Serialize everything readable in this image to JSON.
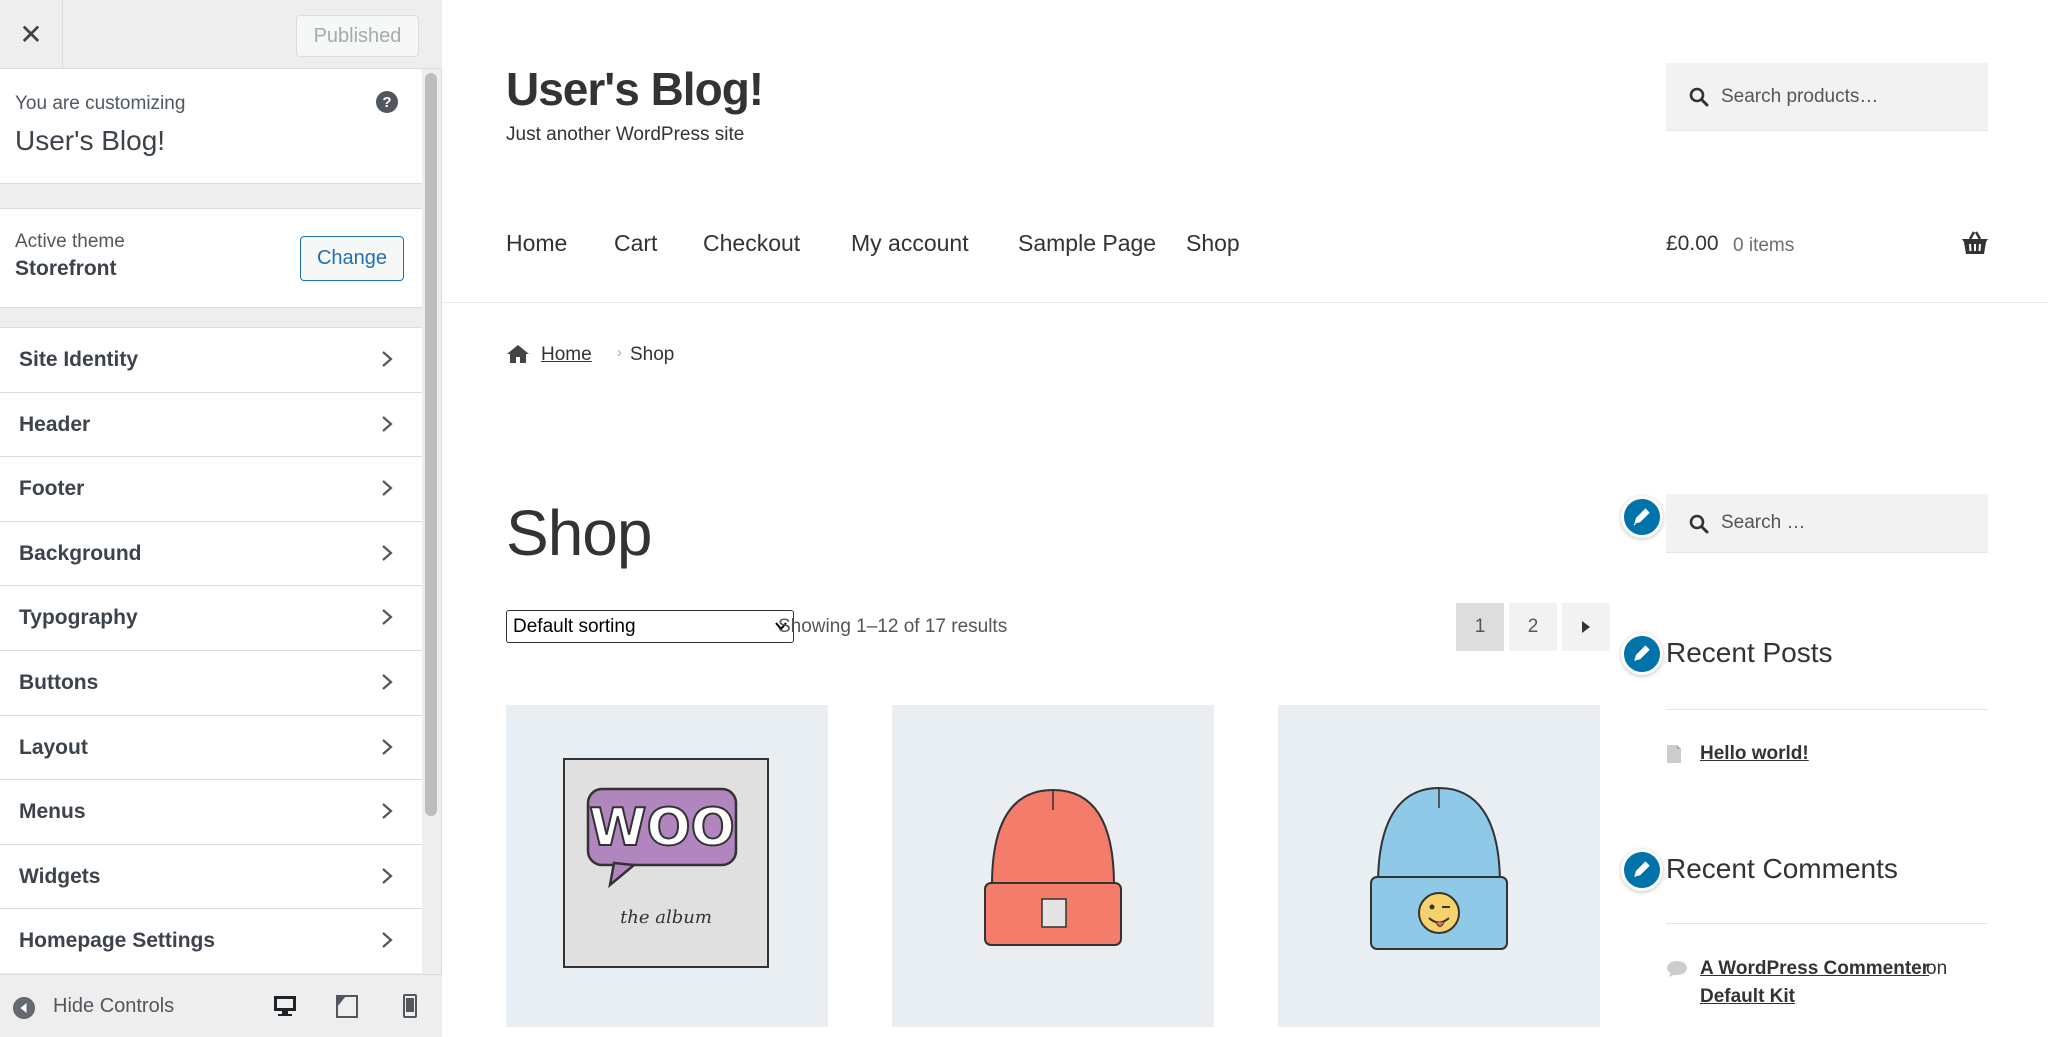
{
  "customizer": {
    "close_label": "✕",
    "publish_label": "Published",
    "info_small": "You are customizing",
    "site_name": "User's Blog!",
    "help_label": "?",
    "active_theme_label": "Active theme",
    "theme_name": "Storefront",
    "change_label": "Change",
    "sections": [
      {
        "label": "Site Identity"
      },
      {
        "label": "Header"
      },
      {
        "label": "Footer"
      },
      {
        "label": "Background"
      },
      {
        "label": "Typography"
      },
      {
        "label": "Buttons"
      },
      {
        "label": "Layout"
      },
      {
        "label": "Menus"
      },
      {
        "label": "Widgets"
      },
      {
        "label": "Homepage Settings"
      }
    ],
    "hide_controls_label": "Hide Controls"
  },
  "site": {
    "title": "User's Blog!",
    "tagline": "Just another WordPress site",
    "search_placeholder": "Search products…",
    "nav": [
      "Home",
      "Cart",
      "Checkout",
      "My account",
      "Sample Page",
      "Shop"
    ],
    "cart_total": "£0.00",
    "cart_items": "0 items"
  },
  "breadcrumb": {
    "home": "Home",
    "current": "Shop"
  },
  "shop": {
    "title": "Shop",
    "sorting": "Default sorting",
    "result_count": "Showing 1–12 of 17 results",
    "pages": [
      "1",
      "2"
    ],
    "current_page": "1"
  },
  "products": [
    {
      "image": "woo-album-image",
      "art_text": "WOO",
      "art_caption": "the album"
    },
    {
      "image": "red-beanie-image"
    },
    {
      "image": "blue-beanie-image"
    }
  ],
  "widgets": {
    "search_placeholder": "Search …",
    "recent_posts_title": "Recent Posts",
    "recent_posts": [
      "Hello world!"
    ],
    "recent_comments_title": "Recent Comments",
    "comment_author": "A WordPress Commenter",
    "comment_on": "on",
    "comment_post": "Default Kit"
  },
  "colors": {
    "accent": "#0073aa",
    "link_blue": "#2271b1",
    "customizer_bg": "#eeeeee"
  }
}
